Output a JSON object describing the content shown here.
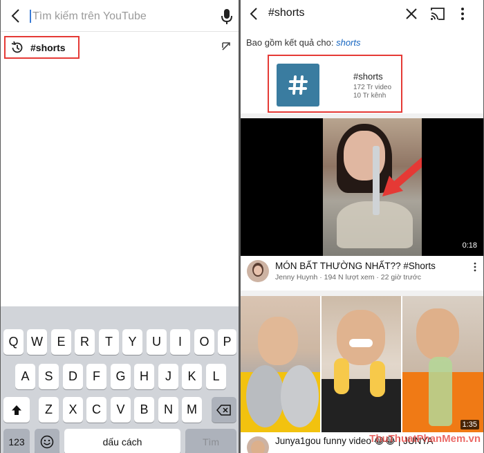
{
  "left": {
    "search_placeholder": "Tìm kiếm trên YouTube",
    "history_item": "#shorts",
    "keyboard": {
      "row1": [
        "Q",
        "W",
        "E",
        "R",
        "T",
        "Y",
        "U",
        "I",
        "O",
        "P"
      ],
      "row2": [
        "A",
        "S",
        "D",
        "F",
        "G",
        "H",
        "J",
        "K",
        "L"
      ],
      "row3": [
        "Z",
        "X",
        "C",
        "V",
        "B",
        "N",
        "M"
      ],
      "numbers_label": "123",
      "space_label": "dấu cách",
      "search_key_label": "Tìm"
    }
  },
  "right": {
    "title": "#shorts",
    "included_prefix": "Bao gồm kết quả cho: ",
    "included_query": "shorts",
    "hashtag": {
      "name": "#shorts",
      "videos": "172 Tr video",
      "channels": "10 Tr kênh"
    },
    "video1": {
      "title": "MÓN BẤT THƯỜNG NHẤT?? #Shorts",
      "subtitle": "Jenny Huynh · 194 N lượt xem · 22 giờ trước",
      "duration": "0:18"
    },
    "video2": {
      "title": "Junya1gou funny video 😂😂 | JUNYA",
      "duration": "1:35"
    },
    "watermark": "ThuThuatPhanMem.vn",
    "colors": {
      "highlight": "#e53935",
      "hashtag_tile": "#3a7ca0",
      "link": "#1565c0"
    }
  }
}
